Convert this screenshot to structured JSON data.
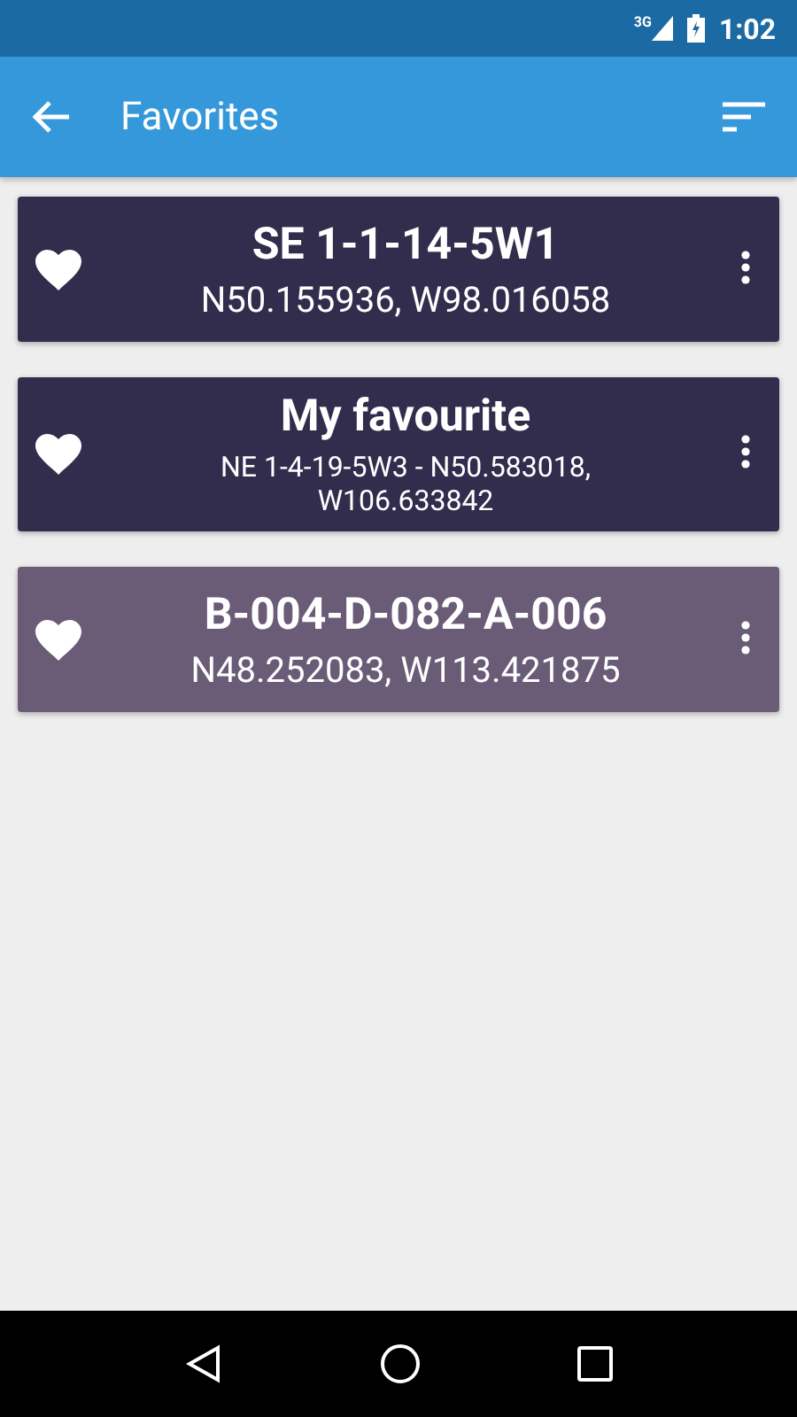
{
  "status_bar": {
    "network": "3G",
    "time": "1:02"
  },
  "app_bar": {
    "title": "Favorites"
  },
  "favorites": [
    {
      "kind": "coordinates",
      "title": "SE 1-1-14-5W1",
      "subtitle": "N50.155936, W98.016058",
      "color": "#332d4d"
    },
    {
      "kind": "named",
      "title": "My favourite",
      "subtitle": "NE 1-4-19-5W3  -  N50.583018, W106.633842",
      "color": "#332d4d"
    },
    {
      "kind": "coordinates",
      "title": "B-004-D-082-A-006",
      "subtitle": "N48.252083, W113.421875",
      "color": "#6a5b77"
    }
  ]
}
